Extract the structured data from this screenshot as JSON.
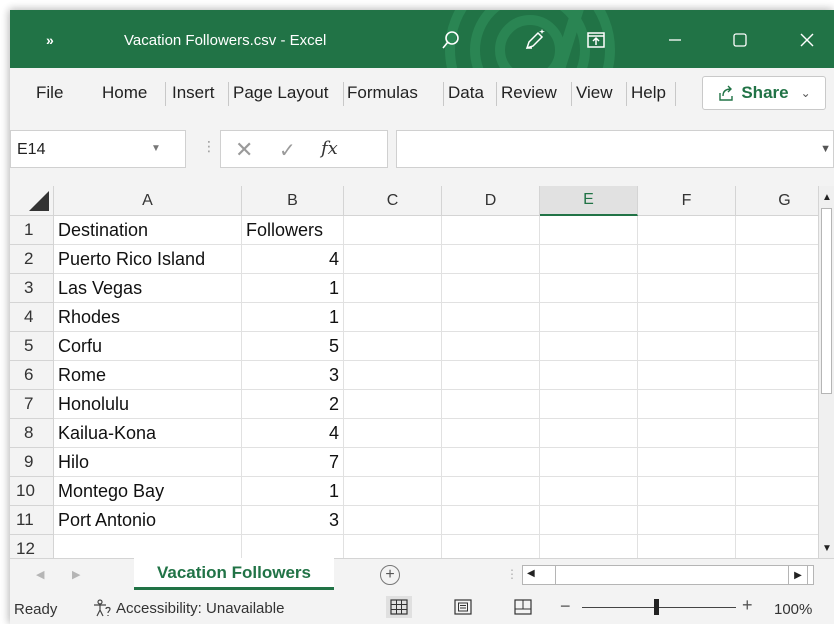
{
  "window": {
    "title": "Vacation Followers.csv  -  Excel",
    "chevron": "»"
  },
  "menu": {
    "items": [
      "File",
      "Home",
      "Insert",
      "Page Layout",
      "Formulas",
      "Data",
      "Review",
      "View",
      "Help"
    ],
    "share_label": "Share"
  },
  "formula_bar": {
    "name_box": "E14",
    "fx_label": "fx",
    "formula_value": ""
  },
  "grid": {
    "columns": [
      "A",
      "B",
      "C",
      "D",
      "E",
      "F",
      "G"
    ],
    "selected_column": "E",
    "rows": [
      {
        "num": "1",
        "a": "Destination",
        "b": "Followers"
      },
      {
        "num": "2",
        "a": "Puerto Rico Island",
        "b": "4"
      },
      {
        "num": "3",
        "a": "Las Vegas",
        "b": "1"
      },
      {
        "num": "4",
        "a": "Rhodes",
        "b": "1"
      },
      {
        "num": "5",
        "a": "Corfu",
        "b": "5"
      },
      {
        "num": "6",
        "a": "Rome",
        "b": "3"
      },
      {
        "num": "7",
        "a": "Honolulu",
        "b": "2"
      },
      {
        "num": "8",
        "a": "Kailua-Kona",
        "b": "4"
      },
      {
        "num": "9",
        "a": "Hilo",
        "b": "7"
      },
      {
        "num": "10",
        "a": "Montego Bay",
        "b": "1"
      },
      {
        "num": "11",
        "a": "Port Antonio",
        "b": "3"
      },
      {
        "num": "12",
        "a": "",
        "b": ""
      }
    ]
  },
  "sheets": {
    "active": "Vacation Followers"
  },
  "status": {
    "ready": "Ready",
    "accessibility": "Accessibility: Unavailable",
    "zoom": "100%"
  },
  "colors": {
    "brand": "#217346",
    "grid_line": "#e1e1e1",
    "header_bg": "#f3f3f3"
  }
}
